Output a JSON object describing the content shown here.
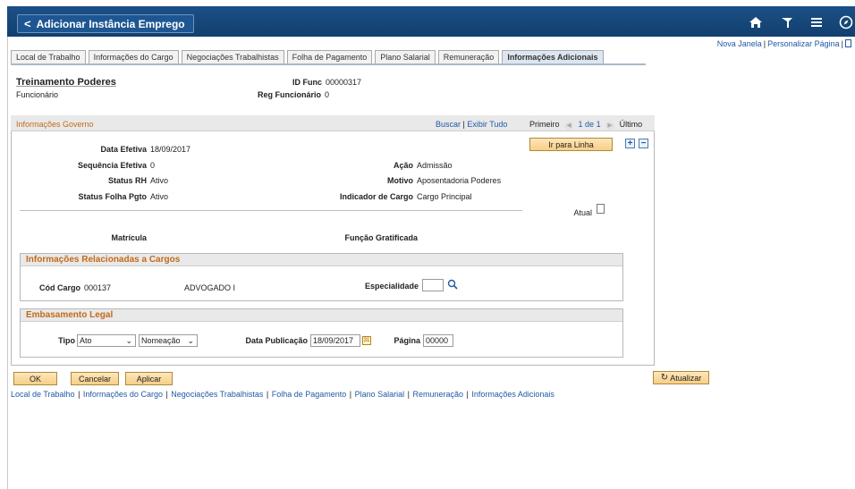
{
  "header": {
    "back_label": "Adicionar Instância Emprego",
    "icons": [
      "home-icon",
      "flag-icon",
      "menu-icon",
      "compass-icon"
    ],
    "bg_color": "#15467a"
  },
  "top_links": {
    "new_window": "Nova Janela",
    "personalize": "Personalizar Página"
  },
  "tabs": [
    {
      "label": "Local de Trabalho"
    },
    {
      "label": "Informações do Cargo"
    },
    {
      "label": "Negociações Trabalhistas"
    },
    {
      "label": "Folha de Pagamento"
    },
    {
      "label": "Plano Salarial"
    },
    {
      "label": "Remuneração"
    },
    {
      "label": "Informações Adicionais",
      "active": true
    }
  ],
  "employee": {
    "name": "Treinamento Poderes",
    "role": "Funcionário",
    "id_label": "ID Func",
    "id_value": "00000317",
    "reg_label": "Reg Funcionário",
    "reg_value": "0"
  },
  "grid": {
    "title": "Informações Governo",
    "find": "Buscar",
    "view_all": "Exibir Tudo",
    "first": "Primeiro",
    "count": "1 de 1",
    "last": "Último",
    "goto_row": "Ir para Linha"
  },
  "fields": {
    "data_efetiva_label": "Data Efetiva",
    "data_efetiva": "18/09/2017",
    "seq_label": "Sequência Efetiva",
    "seq": "0",
    "status_rh_label": "Status RH",
    "status_rh": "Ativo",
    "status_folha_label": "Status Folha Pgto",
    "status_folha": "Ativo",
    "acao_label": "Ação",
    "acao": "Admissão",
    "motivo_label": "Motivo",
    "motivo": "Aposentadoria Poderes",
    "indicador_label": "Indicador de Cargo",
    "indicador": "Cargo Principal",
    "atual_label": "Atual",
    "matricula_label": "Matrícula",
    "funcao_label": "Função Gratificada"
  },
  "cargos": {
    "title": "Informações Relacionadas a Cargos",
    "cod_label": "Cód Cargo",
    "cod": "000137",
    "desc": "ADVOGADO I",
    "esp_label": "Especialidade",
    "esp_value": ""
  },
  "legal": {
    "title": "Embasamento Legal",
    "tipo_label": "Tipo",
    "tipo": "Ato",
    "tipo2": "Nomeação",
    "data_pub_label": "Data Publicação",
    "data_pub": "18/09/2017",
    "pagina_label": "Página",
    "pagina": "00000"
  },
  "buttons": {
    "ok": "OK",
    "cancel": "Cancelar",
    "apply": "Aplicar",
    "refresh": "Atualizar"
  },
  "bottom_links": [
    "Local de Trabalho",
    "Informações do Cargo",
    "Negociações Trabalhistas",
    "Folha de Pagamento",
    "Plano Salarial",
    "Remuneração",
    "Informações Adicionais"
  ]
}
